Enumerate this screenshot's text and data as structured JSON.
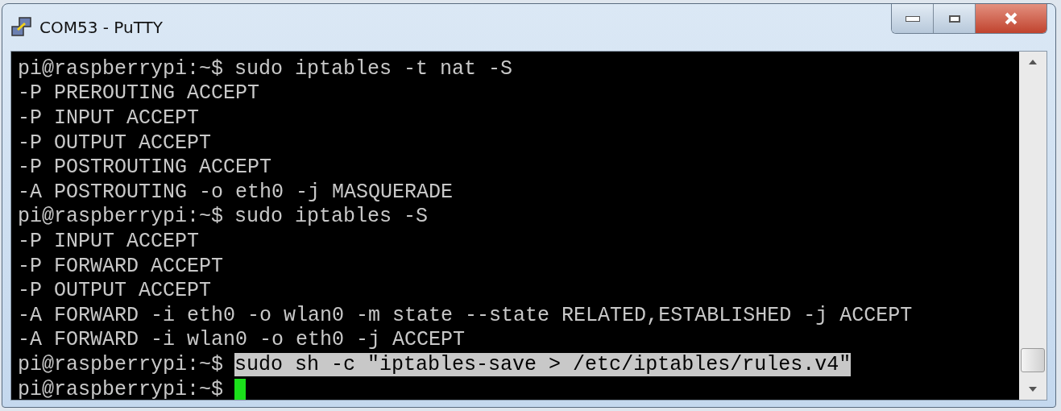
{
  "window": {
    "title": "COM53 - PuTTY"
  },
  "terminal": {
    "lines": [
      {
        "kind": "prompt",
        "prompt": "pi@raspberrypi:~$",
        "command": "sudo iptables -t nat -S",
        "selected": false,
        "cursor": false
      },
      {
        "kind": "output",
        "text": "-P PREROUTING ACCEPT"
      },
      {
        "kind": "output",
        "text": "-P INPUT ACCEPT"
      },
      {
        "kind": "output",
        "text": "-P OUTPUT ACCEPT"
      },
      {
        "kind": "output",
        "text": "-P POSTROUTING ACCEPT"
      },
      {
        "kind": "output",
        "text": "-A POSTROUTING -o eth0 -j MASQUERADE"
      },
      {
        "kind": "prompt",
        "prompt": "pi@raspberrypi:~$",
        "command": "sudo iptables -S",
        "selected": false,
        "cursor": false
      },
      {
        "kind": "output",
        "text": "-P INPUT ACCEPT"
      },
      {
        "kind": "output",
        "text": "-P FORWARD ACCEPT"
      },
      {
        "kind": "output",
        "text": "-P OUTPUT ACCEPT"
      },
      {
        "kind": "output",
        "text": "-A FORWARD -i eth0 -o wlan0 -m state --state RELATED,ESTABLISHED -j ACCEPT"
      },
      {
        "kind": "output",
        "text": "-A FORWARD -i wlan0 -o eth0 -j ACCEPT"
      },
      {
        "kind": "prompt",
        "prompt": "pi@raspberrypi:~$",
        "command": "sudo sh -c \"iptables-save > /etc/iptables/rules.v4\"",
        "selected": true,
        "cursor": false
      },
      {
        "kind": "prompt",
        "prompt": "pi@raspberrypi:~$",
        "cursor": true
      }
    ]
  }
}
